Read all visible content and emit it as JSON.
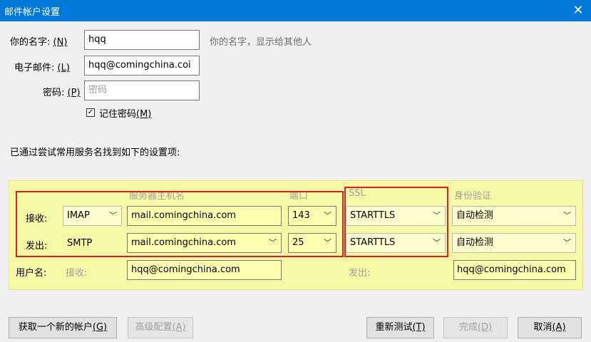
{
  "window": {
    "title": "邮件帐户设置",
    "close_glyph": "✕"
  },
  "form": {
    "name_label": "你的名字:",
    "name_key": "(N)",
    "name_value": "hqq",
    "name_hint": "你的名字，显示给其他人",
    "email_label": "电子邮件:",
    "email_key": "(L)",
    "email_value": "hqq@comingchina.coi",
    "password_label": "密码:",
    "password_key": "(P)",
    "password_placeholder": "密码",
    "remember_label": "记住密码",
    "remember_key": "(M)",
    "remember_checked": true,
    "found_text": "已通过尝试常用服务名找到如下的设置项:"
  },
  "server": {
    "col_hostname": "服务器主机名",
    "col_port": "端口",
    "col_ssl": "SSL",
    "col_auth": "身份验证",
    "incoming": {
      "label": "接收:",
      "protocol": "IMAP",
      "hostname": "mail.comingchina.com",
      "port": "143",
      "ssl": "STARTTLS",
      "auth": "自动检测"
    },
    "outgoing": {
      "label": "发出:",
      "protocol": "SMTP",
      "hostname": "mail.comingchina.com",
      "port": "25",
      "ssl": "STARTTLS",
      "auth": "自动检测"
    },
    "username_label": "用户名:",
    "username_in_label": "接收:",
    "username_in_value": "hqq@comingchina.com",
    "username_out_label": "发出:",
    "username_out_value": "hqq@comingchina.com"
  },
  "buttons": {
    "new_account": "获取一个新的帐户",
    "new_account_key": "(G)",
    "advanced": "高级配置",
    "advanced_key": "(A)",
    "retest": "重新测试",
    "retest_key": "(T)",
    "done": "完成",
    "done_key": "(D)",
    "cancel": "取消",
    "cancel_key": "(A)"
  },
  "colors": {
    "titlebar": "#0078d7",
    "panel": "#f7f8a6",
    "highlight_box": "#e02020"
  },
  "icons": {
    "dropdown": "chevron-down-icon",
    "close": "close-icon",
    "check": "check-icon"
  }
}
